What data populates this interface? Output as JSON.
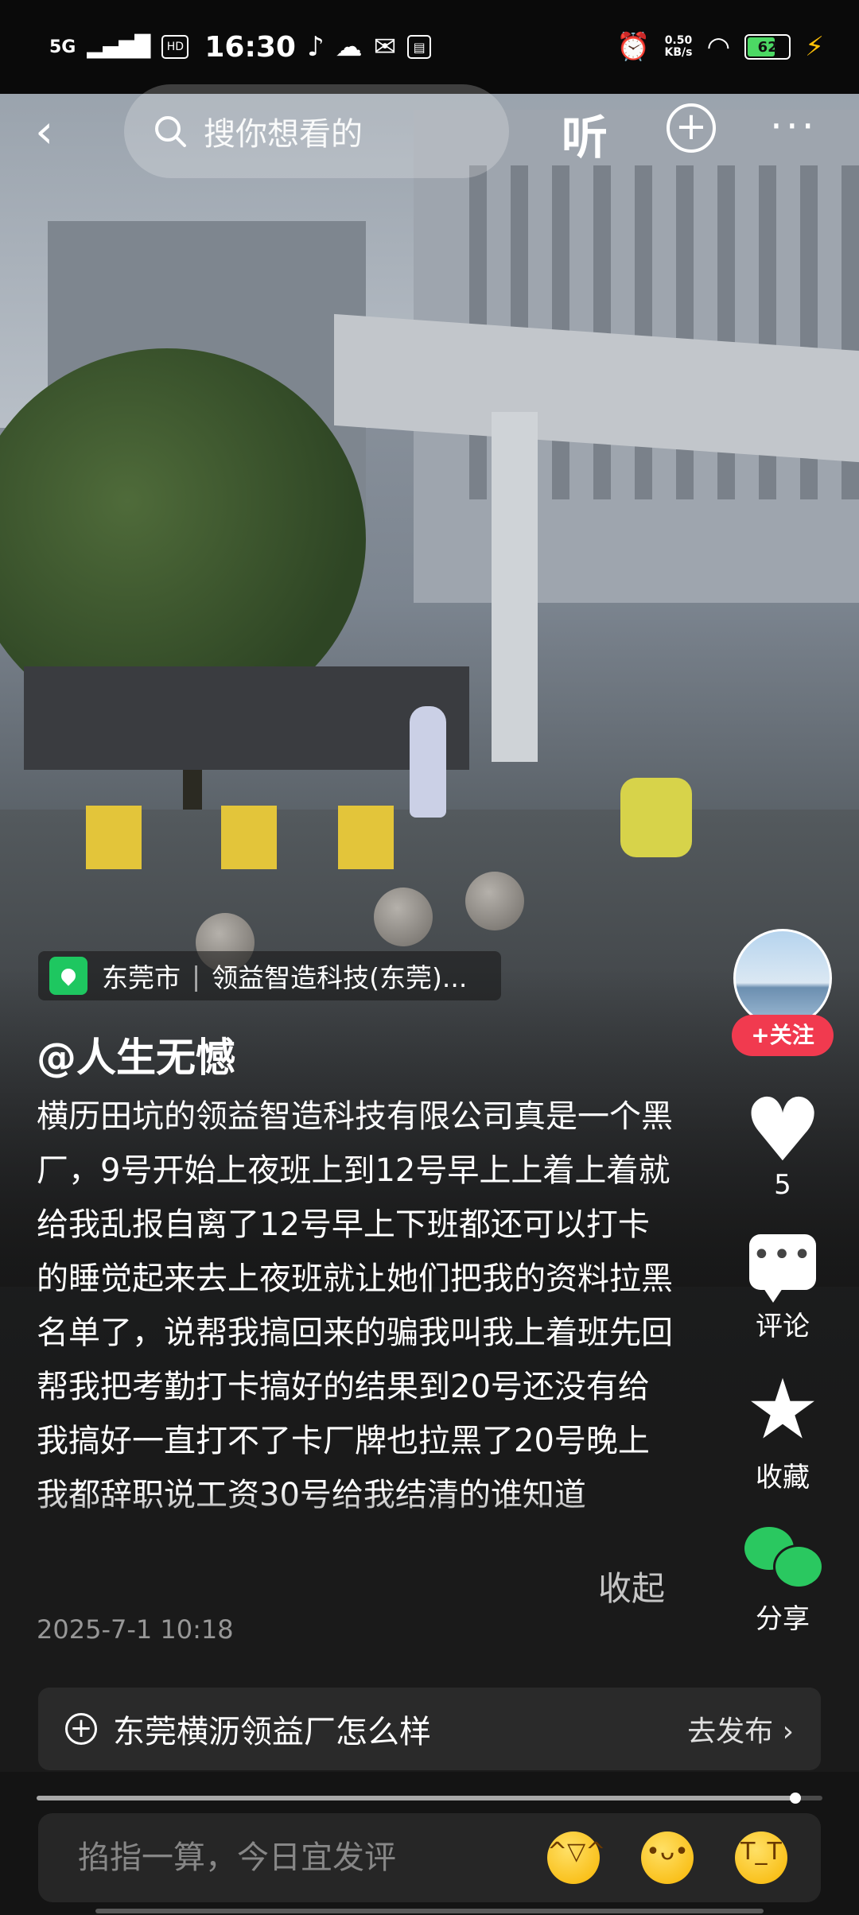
{
  "status_bar": {
    "network": "5G",
    "hd": "HD",
    "time": "16:30",
    "speed_value": "0.50",
    "speed_unit": "KB/s",
    "battery": "62"
  },
  "top_bar": {
    "search_placeholder": "搜你想看的",
    "listen_label": "听",
    "more_label": "···"
  },
  "location": {
    "city": "东莞市",
    "place": "领益智造科技(东莞)..."
  },
  "post": {
    "author": "@人生无憾",
    "description": "横历田坑的领益智造科技有限公司真是一个黑厂，9号开始上夜班上到12号早上上着上着就给我乱报自离了12号早上下班都还可以打卡的睡觉起来去上夜班就让她们把我的资料拉黑名单了，说帮我搞回来的骗我叫我上着班先回帮我把考勤打卡搞好的结果到20号还没有给我搞好一直打不了卡厂牌也拉黑了20号晚上我都辞职说工资30号给我结清的谁知道",
    "collapse_label": "收起",
    "timestamp": "2025-7-1 10:18"
  },
  "actions": {
    "follow_label": "+关注",
    "likes": "5",
    "comment_label": "评论",
    "favorite_label": "收藏",
    "share_label": "分享"
  },
  "topic": {
    "text": "东莞横沥领益厂怎么样",
    "action": "去发布 ›"
  },
  "playback": {
    "progress": 0.966
  },
  "comment_bar": {
    "placeholder": "掐指一算，今日宜发评"
  },
  "colors": {
    "follow_red": "#f13a4f",
    "location_green": "#1ec760",
    "battery_green": "#4cd964",
    "wechat_green": "#2ac860"
  }
}
